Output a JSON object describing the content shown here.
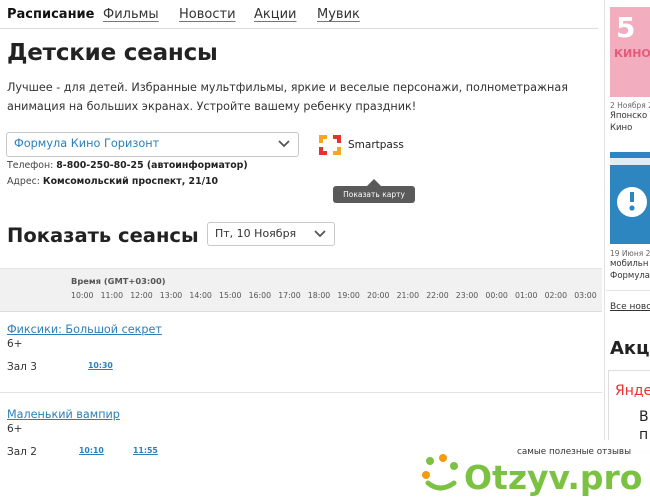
{
  "nav": {
    "items": [
      {
        "label": "Расписание"
      },
      {
        "label": "Фильмы"
      },
      {
        "label": "Новости"
      },
      {
        "label": "Акции"
      },
      {
        "label": "Мувик"
      }
    ]
  },
  "page": {
    "title": "Детские сеансы",
    "intro": "Лучшее - для детей. Избранные мультфильмы, яркие и веселые персонажи, полнометражная анимация на больших экранах. Устройте вашему ребенку праздник!"
  },
  "cinema": {
    "selected": "Формула Кино Горизонт",
    "smartpass": "Smartpass",
    "phone_label": "Телефон:",
    "phone_value": "8-800-250-80-25 (автоинформатор)",
    "address_label": "Адрес:",
    "address_value": "Комсомольский проспект, 21/10",
    "map_button": "Показать карту"
  },
  "date_picker": {
    "label": "Показать сеансы на",
    "selected": "Пт, 10 Ноября"
  },
  "schedule": {
    "header": "Время (GMT+03:00)",
    "hours": [
      "10:00",
      "11:00",
      "12:00",
      "13:00",
      "14:00",
      "15:00",
      "16:00",
      "17:00",
      "18:00",
      "19:00",
      "20:00",
      "21:00",
      "22:00",
      "23:00",
      "00:00",
      "01:00",
      "02:00",
      "03:00"
    ],
    "movies": [
      {
        "title": "Фиксики: Большой секрет",
        "age": "6+",
        "hall": "Зал 3",
        "sessions": [
          "10:30"
        ]
      },
      {
        "title": "Маленький вампир",
        "age": "6+",
        "hall": "Зал 2",
        "sessions": [
          "10:10",
          "11:55"
        ]
      }
    ]
  },
  "sidebar": {
    "card1_date": "2 Ноября 2",
    "card1_line1": "Японско",
    "card1_line2": "Кино",
    "card2_date": "19 Июня 2",
    "card2_line1": "мобильн",
    "card2_line2": "Формула",
    "all_news": "Все ново",
    "promo_heading": "Акц",
    "ad_text1": "Яндек",
    "ad_text2": "В",
    "ad_text3": "п"
  },
  "watermark": {
    "tagline": "самые полезные отзывы",
    "brand": "Otzyv.pro"
  },
  "colors": {
    "link": "#2a7fb8",
    "watermark_green": "#7bc142",
    "watermark_orange": "#f39c12",
    "sidebar_pink": "#f2aebf",
    "sidebar_blue": "#2e86c1"
  }
}
